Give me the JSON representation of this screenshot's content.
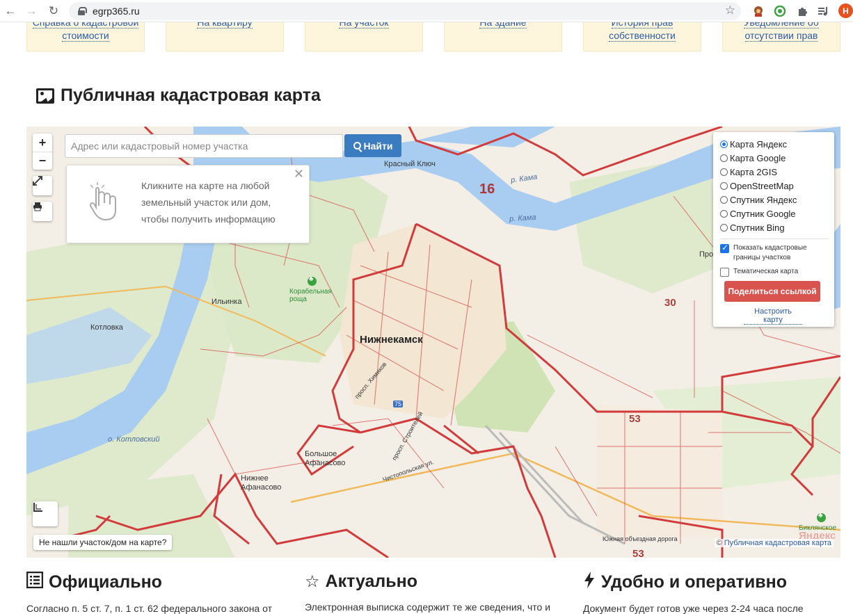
{
  "browser": {
    "url": "egrp365.ru",
    "avatar_letter": "Н"
  },
  "service_cards": [
    {
      "line1": "Справка о кадастровой",
      "line2": "стоимости"
    },
    {
      "line1": "На квартиру",
      "line2": ""
    },
    {
      "line1": "На участок",
      "line2": ""
    },
    {
      "line1": "На здание",
      "line2": ""
    },
    {
      "line1": "История прав",
      "line2": "собственности"
    },
    {
      "line1": "Уведомление об",
      "line2": "отсутствии прав"
    }
  ],
  "map_section": {
    "title": "Публичная кадастровая карта",
    "search_placeholder": "Адрес или кадастровый номер участка",
    "search_button": "Найти",
    "hint_text": "Кликните на карте на любой земельный участок или дом, чтобы получить информацию",
    "zoom_in": "+",
    "zoom_out": "−",
    "layers": {
      "base_maps": [
        "Карта Яндекс",
        "Карта Google",
        "Карта 2GIS",
        "OpenStreetMap",
        "Спутник Яндекс",
        "Спутник Google",
        "Спутник Bing"
      ],
      "selected": "Карта Яндекс",
      "show_boundaries": "Показать кадастровые границы участков",
      "show_boundaries_checked": true,
      "thematic_map": "Тематическая карта",
      "thematic_map_checked": false,
      "share_button": "Поделиться ссылкой",
      "configure_link": "Настроить карту"
    },
    "not_found_button": "Не нашли участок/дом на карте?",
    "attribution_prefix": "©",
    "attribution_link": "Публичная кадастровая карта",
    "labels": {
      "city": "Нижнекамск",
      "krasny_klyuch": "Красный Ключ",
      "kotlovka": "Котловка",
      "ilinka": "Ильинка",
      "korabelnaya": "Корабельная роща",
      "bolshoe": "Большое Афанасово",
      "nizhnee": "Нижнее Афанасово",
      "oz_kotlovsky": "о. Котловский",
      "kama1": "р. Кама",
      "kama2": "р. Кама",
      "biklyan": "Биклянское",
      "zone16": "16",
      "zone30": "30",
      "zone53": "53",
      "zone53b": "53",
      "road75": "75",
      "prosp_khimikov": "просп. Химиков",
      "prosp_stroiteley": "просп. Строителей",
      "chistopolskaya": "Чистопольская ул.",
      "yuzhnaya": "Южная объездная дорога",
      "pro": "Про",
      "yandex": "Яндекс"
    }
  },
  "features": [
    {
      "title": "Официально",
      "text": "Согласно п. 5 ст. 7, п. 1 ст. 62 федерального закона от",
      "icon": "list-icon"
    },
    {
      "title": "Актуально",
      "text": "Электронная выписка содержит те же сведения, что и",
      "icon": "star-icon"
    },
    {
      "title": "Удобно и оперативно",
      "text": "Документ будет готов уже через 2-24 часа после",
      "icon": "bolt-icon"
    }
  ]
}
